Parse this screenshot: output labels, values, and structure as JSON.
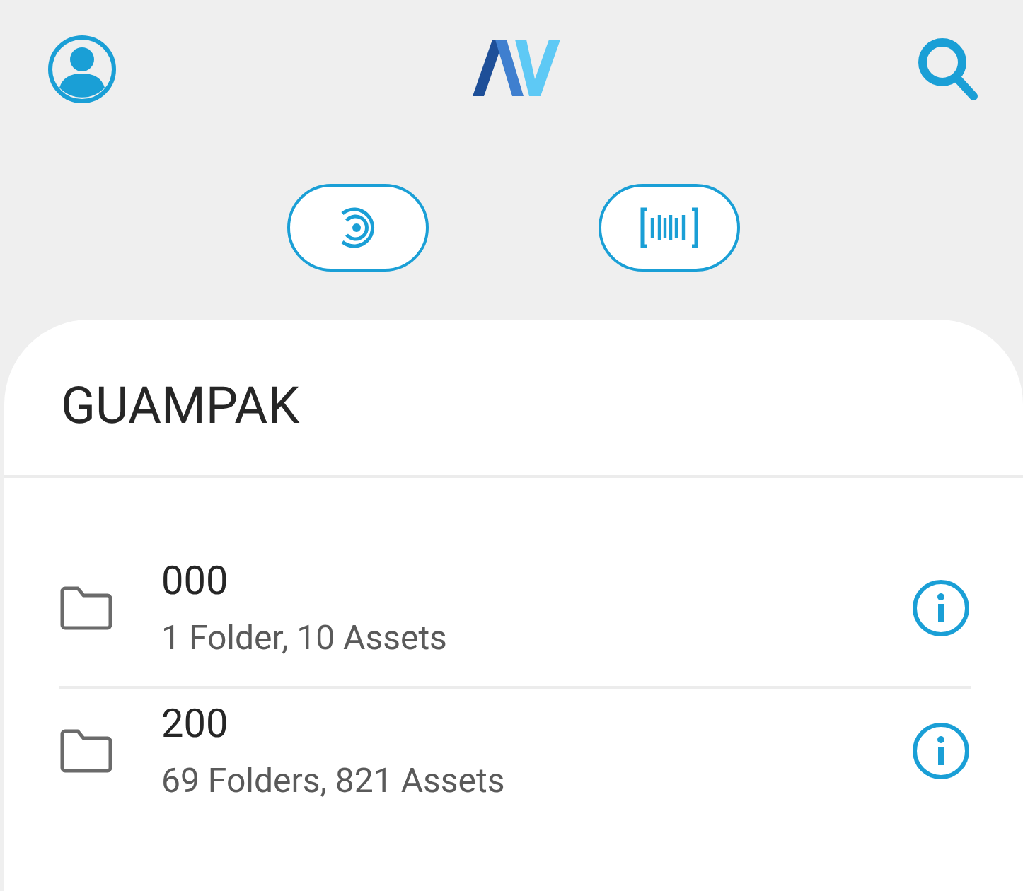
{
  "location": {
    "title": "GUAMPAK"
  },
  "folders": [
    {
      "name": "000",
      "summary": "1 Folder, 10 Assets"
    },
    {
      "name": "200",
      "summary": "69 Folders, 821 Assets"
    }
  ]
}
